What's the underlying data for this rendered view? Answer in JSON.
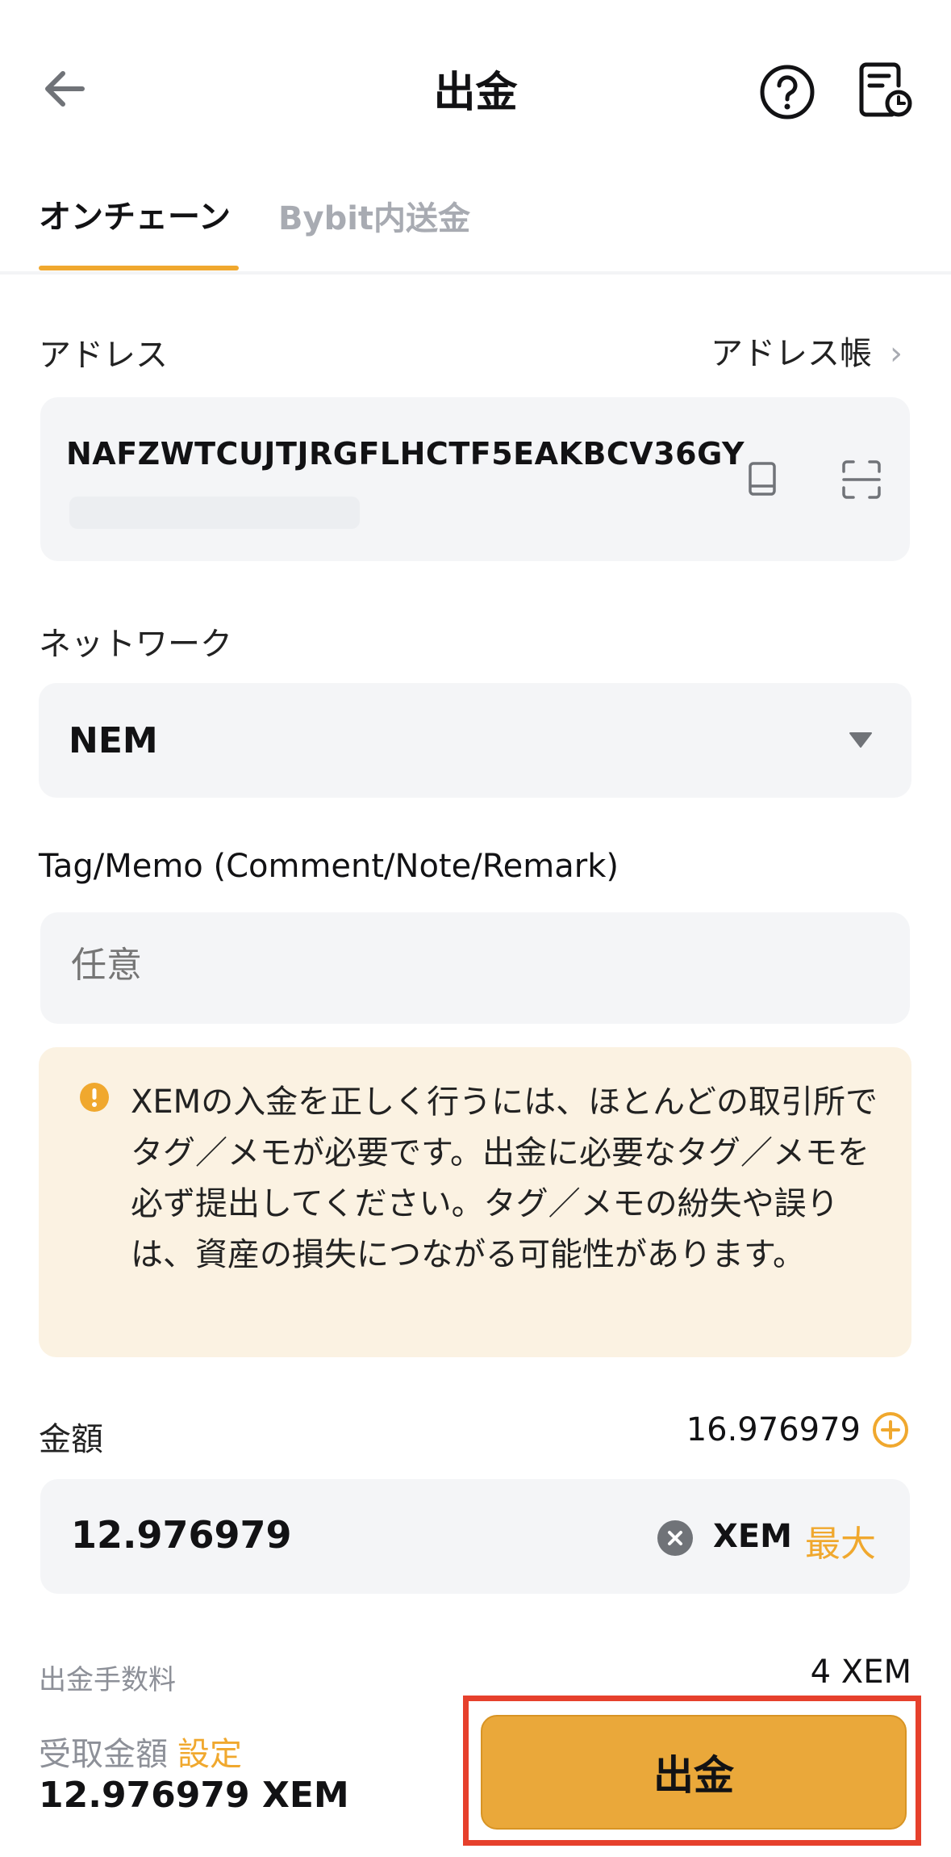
{
  "header": {
    "title": "出金",
    "back_icon": "arrow-left-icon",
    "help_icon": "question-circle-icon",
    "record_icon": "history-document-icon"
  },
  "tabs": [
    {
      "label": "オンチェーン",
      "active": true
    },
    {
      "label": "Bybit内送金",
      "active": false
    }
  ],
  "address": {
    "label": "アドレス",
    "book_link": "アドレス帳",
    "value": "NAFZWTCUJTJRGFLHCTF5EAKBCV36GY"
  },
  "network": {
    "label": "ネットワーク",
    "value": "NEM"
  },
  "memo": {
    "label": "Tag/Memo (Comment/Note/Remark)",
    "placeholder": "任意"
  },
  "warning": {
    "text": "XEMの入金を正しく行うには、ほとんどの取引所でタグ／メモが必要です。出金に必要なタグ／メモを必ず提出してください。タグ／メモの紛失や誤りは、資産の損失につながる可能性があります。"
  },
  "amount": {
    "label": "金額",
    "available": "16.976979",
    "value": "12.976979",
    "unit": "XEM",
    "max_label": "最大"
  },
  "fee": {
    "label": "出金手数料",
    "value": "4 XEM"
  },
  "receive": {
    "label": "受取金額",
    "setting_label": "設定",
    "value": "12.976979 XEM"
  },
  "submit_label": "出金",
  "colors": {
    "accent": "#f0a82e",
    "button": "#eaa83a",
    "warning_bg": "#fbf2e2",
    "highlight": "#e6402c"
  }
}
